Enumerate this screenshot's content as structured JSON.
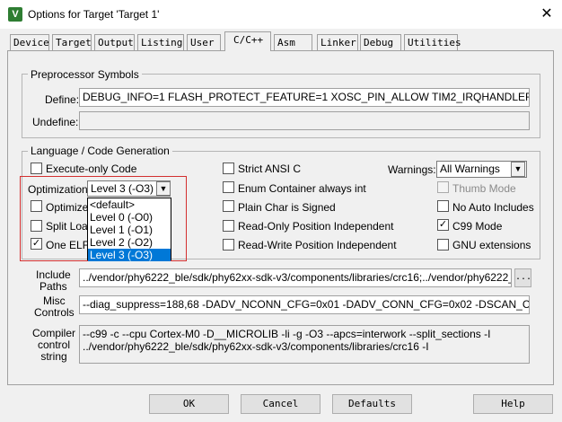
{
  "window": {
    "title": "Options for Target 'Target 1'"
  },
  "tabs": [
    "Device",
    "Target",
    "Output",
    "Listing",
    "User",
    "C/C++",
    "Asm",
    "Linker",
    "Debug",
    "Utilities"
  ],
  "preprocessor": {
    "group_title": "Preprocessor Symbols",
    "define_label": "Define:",
    "define_value": "DEBUG_INFO=1 FLASH_PROTECT_FEATURE=1 XOSC_PIN_ALLOW TIM2_IRQHANDLER1_ENABLI",
    "undefine_label": "Undefine:",
    "undefine_value": ""
  },
  "language": {
    "group_title": "Language / Code Generation",
    "execute_only": "Execute-only Code",
    "optimization_label": "Optimization:",
    "optimization_value": "Level 3 (-O3)",
    "optimize_for_time": "Optimize f",
    "split_load": "Split Load",
    "one_elf": "One ELF",
    "strict_ansi": "Strict ANSI C",
    "enum_container": "Enum Container always int",
    "plain_char": "Plain Char is Signed",
    "ro_pi": "Read-Only Position Independent",
    "rw_pi": "Read-Write Position Independent",
    "warnings_label": "Warnings:",
    "warnings_value": "All Warnings",
    "thumb_mode": "Thumb Mode",
    "no_auto_includes": "No Auto Includes",
    "c99_mode": "C99 Mode",
    "gnu_extensions": "GNU extensions",
    "dropdown_options": [
      "<default>",
      "Level 0 (-O0)",
      "Level 1 (-O1)",
      "Level 2 (-O2)",
      "Level 3 (-O3)"
    ]
  },
  "include": {
    "label": "Include\nPaths",
    "value": "../vendor/phy6222_ble/sdk/phy62xx-sdk-v3/components/libraries/crc16;../vendor/phy6222_ble/sdk",
    "browse": "..."
  },
  "misc": {
    "label": "Misc\nControls",
    "value": "--diag_suppress=188,68 -DADV_NCONN_CFG=0x01 -DADV_CONN_CFG=0x02 -DSCAN_CFG=0x04  -"
  },
  "compiler": {
    "label": "Compiler\ncontrol\nstring",
    "value": "--c99 -c --cpu Cortex-M0 -D__MICROLIB -li -g -O3 --apcs=interwork --split_sections -I\n../vendor/phy6222_ble/sdk/phy62xx-sdk-v3/components/libraries/crc16 -I"
  },
  "buttons": {
    "ok": "OK",
    "cancel": "Cancel",
    "defaults": "Defaults",
    "help": "Help"
  },
  "checks": {
    "one_elf": true,
    "c99_mode": true,
    "checkmark": "✓"
  }
}
